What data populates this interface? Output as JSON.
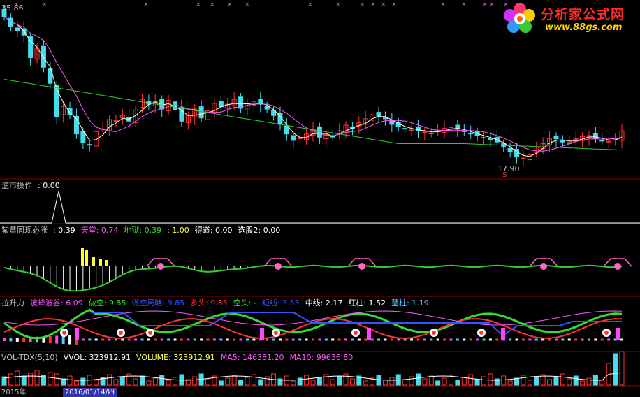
{
  "price_labels": {
    "high": "35.86",
    "low": "17.90",
    "low_marker": "S"
  },
  "panels": {
    "p2": [
      {
        "text": "逆市操作",
        "color": "#c0c0c0"
      },
      {
        "text": ": 0.00",
        "color": "#ffffff"
      }
    ],
    "p3": [
      {
        "text": "紫黄同现必涨",
        "color": "#c0c0c0"
      },
      {
        "text": ": 0.39",
        "color": "#ffffff"
      },
      {
        "text": "天堂: 0.74",
        "color": "#ff55ff"
      },
      {
        "text": "地狱: 0.39",
        "color": "#33dd33"
      },
      {
        "text": ": 1.00",
        "color": "#ffff55"
      },
      {
        "text": "得道: 0.00",
        "color": "#ffffff"
      },
      {
        "text": "选股2: 0.00",
        "color": "#ffffff"
      }
    ],
    "p4": [
      {
        "text": "拉升力",
        "color": "#c0c0c0"
      },
      {
        "text": "波峰波谷: 6.09",
        "color": "#ff55ff"
      },
      {
        "text": "做空: 9.85",
        "color": "#33dd33"
      },
      {
        "text": "做空局略: 9.85",
        "color": "#3355ff"
      },
      {
        "text": "多头: 9.85",
        "color": "#ff3333"
      },
      {
        "text": "空头: -",
        "color": "#33dd33"
      },
      {
        "text": "短线: 3.53",
        "color": "#3355ff"
      },
      {
        "text": "中线: 2.17",
        "color": "#ffffff"
      },
      {
        "text": "红柱: 1.52",
        "color": "#ffffff"
      },
      {
        "text": "蓝柱: 1.19",
        "color": "#55ccff"
      }
    ],
    "p5": [
      {
        "text": "VOL-TDX(5,10)",
        "color": "#c0c0c0"
      },
      {
        "text": "VVOL: 323912.91",
        "color": "#ffffff"
      },
      {
        "text": "VOLUME: 323912.91",
        "color": "#ffff55"
      },
      {
        "text": "MA5: 146381.20",
        "color": "#ff55ff"
      },
      {
        "text": "MA10: 99636.80",
        "color": "#ff55ff"
      }
    ]
  },
  "bottom_axis": {
    "date": "2016/01/14/四",
    "year": "2015年"
  },
  "logo": {
    "title": "分析家公式网",
    "url": "www.88gs.com"
  },
  "colors": {
    "up": "#ff3333",
    "down": "#44ddee",
    "ma5": "#ffffcc",
    "ma10": "#ff55ff",
    "ma60": "#33cc33",
    "grid": "#8b0000",
    "yellow": "#ffff33"
  },
  "chart_data": {
    "type": "candlestick",
    "title": "",
    "xlabel": "",
    "ylabel": "",
    "ylim": [
      17.0,
      37.0
    ],
    "annotations": [
      "35.86",
      "17.90"
    ],
    "series": [
      {
        "name": "price",
        "values": [
          35.8,
          34.6,
          34.0,
          33.5,
          30.7,
          31.8,
          29.5,
          27.5,
          23.3,
          24.6,
          23.6,
          21.2,
          20.1,
          19.9,
          21.5,
          21.8,
          23.0,
          22.9,
          23.5,
          22.8,
          24.2,
          25.5,
          24.9,
          25.2,
          24.3,
          25.4,
          24.2,
          22.8,
          23.5,
          24.3,
          23.2,
          24.1,
          25.0,
          24.6,
          24.9,
          25.5,
          24.4,
          25.0,
          25.2,
          24.9,
          24.3,
          23.5,
          22.4,
          21.2,
          20.4,
          20.7,
          21.2,
          21.8,
          20.8,
          21.1,
          20.9,
          21.6,
          22.3,
          21.9,
          22.6,
          23.1,
          23.6,
          23.4,
          23.1,
          22.4,
          22.1,
          21.9,
          21.7,
          21.6,
          21.5,
          21.3,
          21.6,
          21.9,
          22.0,
          21.8,
          21.5,
          21.2,
          21.0,
          20.8,
          20.5,
          20.2,
          19.6,
          19.0,
          18.4,
          18.2,
          18.6,
          19.6,
          20.0,
          20.6,
          20.6,
          20.2,
          20.2,
          20.6,
          20.9,
          21.0,
          20.6,
          20.4,
          20.3,
          20.6,
          21.6
        ]
      }
    ]
  }
}
